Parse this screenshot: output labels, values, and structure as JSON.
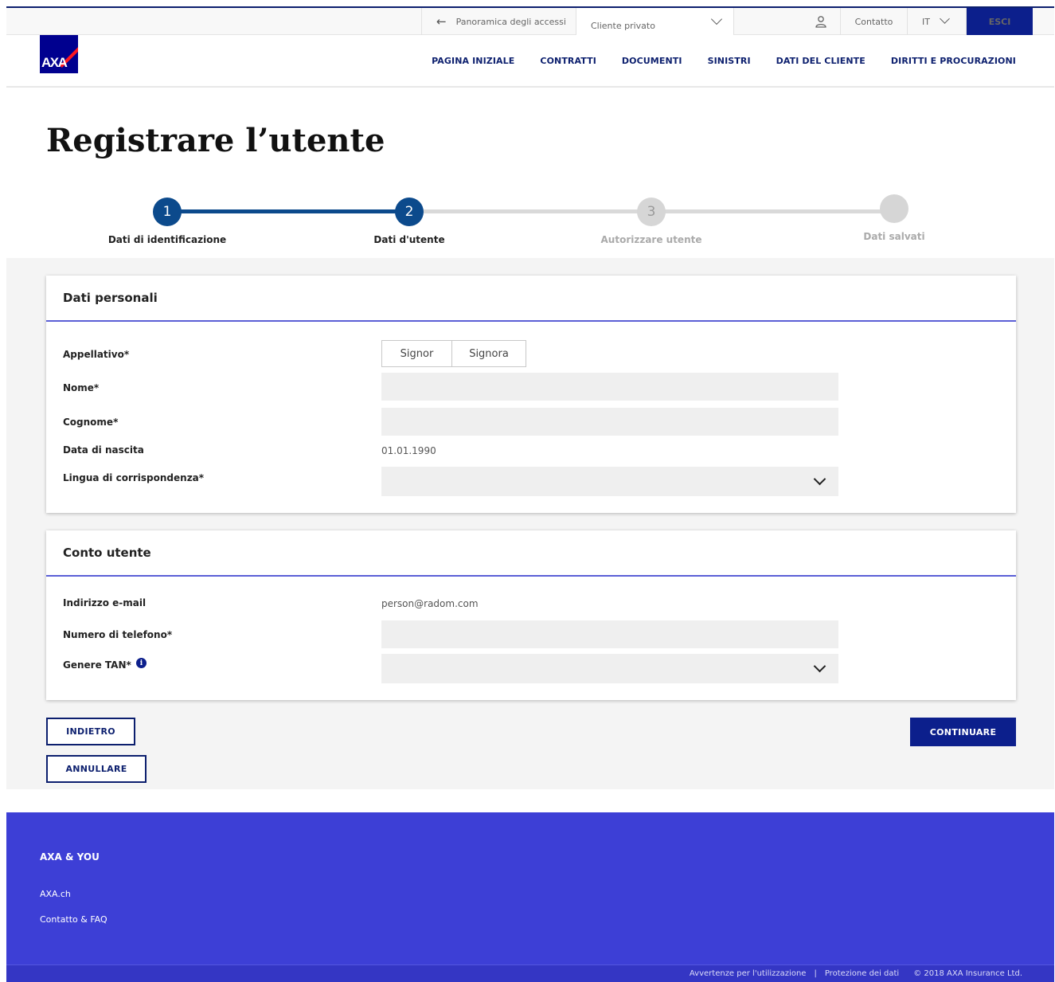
{
  "topbar": {
    "back_label": "Panoramica degli accessi",
    "client_select": "Cliente privato",
    "contact": "Contatto",
    "language": "IT",
    "logout": "ESCI"
  },
  "header": {
    "logo_text": "AXA",
    "nav": [
      "PAGINA INIZIALE",
      "CONTRATTI",
      "DOCUMENTI",
      "SINISTRI",
      "DATI DEL CLIENTE",
      "DIRITTI E PROCURAZIONI"
    ]
  },
  "page_title": "Registrare l’utente",
  "stepper": {
    "steps": [
      {
        "number": "1",
        "label": "Dati di identificazione"
      },
      {
        "number": "2",
        "label": "Dati d'utente"
      },
      {
        "number": "3",
        "label": "Autorizzare utente"
      },
      {
        "number": "",
        "label": "Dati salvati"
      }
    ]
  },
  "personal": {
    "heading": "Dati personali",
    "salutation_label": "Appellativo*",
    "salutation_options": [
      "Signor",
      "Signora"
    ],
    "first_name_label": "Nome*",
    "first_name_value": "",
    "last_name_label": "Cognome*",
    "last_name_value": "",
    "birthdate_label": "Data di nascita",
    "birthdate_value": "01.01.1990",
    "language_label": "Lingua di corrispondenza*",
    "language_value": ""
  },
  "account": {
    "heading": "Conto utente",
    "email_label": "Indirizzo e-mail",
    "email_value": "person@radom.com",
    "phone_label": "Numero di telefono*",
    "phone_value": "",
    "tan_label": "Genere TAN*",
    "tan_value": ""
  },
  "actions": {
    "back": "INDIETRO",
    "cancel": "ANNULLARE",
    "continue": "CONTINUARE"
  },
  "footer": {
    "heading": "AXA & YOU",
    "links": [
      "AXA.ch",
      "Contatto & FAQ"
    ],
    "legal": [
      "Avvertenze per l'utilizzazione",
      "Protezione dei dati",
      "© 2018 AXA Insurance Ltd."
    ]
  },
  "colors": {
    "brand_navy": "#0c1f8c",
    "step_active": "#0c4a8c",
    "card_rule": "#5b5fd6",
    "footer_bg": "#3d3fd6"
  }
}
